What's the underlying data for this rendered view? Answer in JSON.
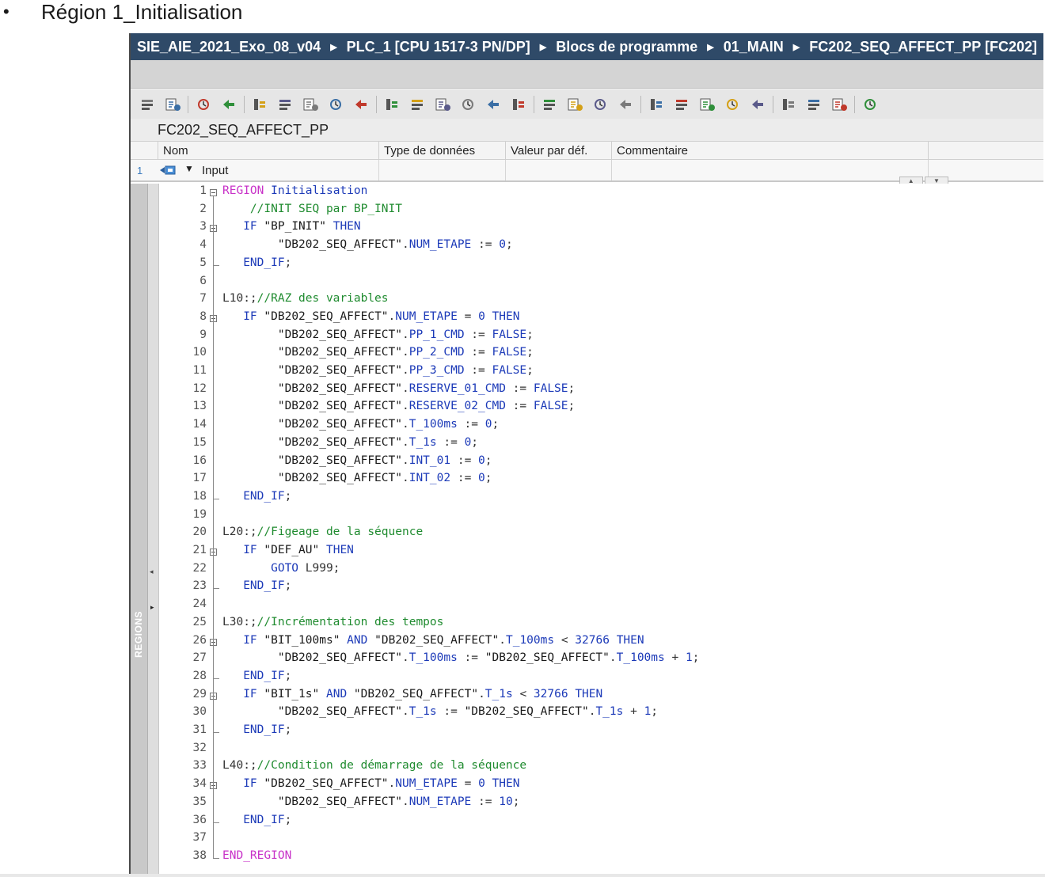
{
  "slide": {
    "bullet": "•",
    "title": "Région 1_Initialisation"
  },
  "breadcrumb": {
    "items": [
      "SIE_AIE_2021_Exo_08_v04",
      "PLC_1 [CPU 1517-3 PN/DP]",
      "Blocs de programme",
      "01_MAIN",
      "FC202_SEQ_AFFECT_PP [FC202]"
    ],
    "separator": "▶"
  },
  "toolbar": {
    "icons": [
      "insert-network-icon",
      "delete-network-icon",
      "insert-row-icon",
      "add-row-icon",
      "indent-icon",
      "outdent-icon",
      "comment-icon",
      "uncomment-icon",
      "favorites-icon",
      "breakpoint-icon",
      "clear-breakpoints-icon",
      "watch-icon",
      "snapshot-icon",
      "list-icon",
      "download-icon",
      "goto-prev-icon",
      "goto-next-icon",
      "expand-icon",
      "collapse-icon",
      "bookmark-icon",
      "bookmark-next-icon",
      "monitor-icon",
      "step-into-icon",
      "step-out-icon",
      "cross-ref-icon",
      "glasses-icon",
      "glasses-2-icon",
      "database-icon"
    ]
  },
  "block": {
    "title": "FC202_SEQ_AFFECT_PP"
  },
  "interface": {
    "columns": [
      "Nom",
      "Type de données",
      "Valeur par déf.",
      "Commentaire"
    ],
    "row": {
      "number": "1",
      "label": "Input"
    }
  },
  "regions_label": "REGIONS",
  "code_lines": [
    {
      "n": "1",
      "t": "REGION Initialisation"
    },
    {
      "n": "2",
      "t": "    //INIT SEQ par BP_INIT"
    },
    {
      "n": "3",
      "t": "    IF \"BP_INIT\" THEN"
    },
    {
      "n": "4",
      "t": "        \"DB202_SEQ_AFFECT\".NUM_ETAPE := 0;"
    },
    {
      "n": "5",
      "t": "    END_IF;"
    },
    {
      "n": "6",
      "t": ""
    },
    {
      "n": "7",
      "t": "L10:;//RAZ des variables"
    },
    {
      "n": "8",
      "t": "    IF \"DB202_SEQ_AFFECT\".NUM_ETAPE = 0 THEN"
    },
    {
      "n": "9",
      "t": "        \"DB202_SEQ_AFFECT\".PP_1_CMD := FALSE;"
    },
    {
      "n": "10",
      "t": "        \"DB202_SEQ_AFFECT\".PP_2_CMD := FALSE;"
    },
    {
      "n": "11",
      "t": "        \"DB202_SEQ_AFFECT\".PP_3_CMD := FALSE;"
    },
    {
      "n": "12",
      "t": "        \"DB202_SEQ_AFFECT\".RESERVE_01_CMD := FALSE;"
    },
    {
      "n": "13",
      "t": "        \"DB202_SEQ_AFFECT\".RESERVE_02_CMD := FALSE;"
    },
    {
      "n": "14",
      "t": "        \"DB202_SEQ_AFFECT\".T_100ms := 0;"
    },
    {
      "n": "15",
      "t": "        \"DB202_SEQ_AFFECT\".T_1s := 0;"
    },
    {
      "n": "16",
      "t": "        \"DB202_SEQ_AFFECT\".INT_01 := 0;"
    },
    {
      "n": "17",
      "t": "        \"DB202_SEQ_AFFECT\".INT_02 := 0;"
    },
    {
      "n": "18",
      "t": "    END_IF;"
    },
    {
      "n": "19",
      "t": ""
    },
    {
      "n": "20",
      "t": "L20:;//Figeage de la séquence"
    },
    {
      "n": "21",
      "t": "    IF \"DEF_AU\" THEN"
    },
    {
      "n": "22",
      "t": "        GOTO L999;"
    },
    {
      "n": "23",
      "t": "    END_IF;"
    },
    {
      "n": "24",
      "t": ""
    },
    {
      "n": "25",
      "t": "L30:;//Incrémentation des tempos"
    },
    {
      "n": "26",
      "t": "    IF \"BIT_100ms\" AND \"DB202_SEQ_AFFECT\".T_100ms < 32766 THEN"
    },
    {
      "n": "27",
      "t": "        \"DB202_SEQ_AFFECT\".T_100ms := \"DB202_SEQ_AFFECT\".T_100ms + 1;"
    },
    {
      "n": "28",
      "t": "    END_IF;"
    },
    {
      "n": "29",
      "t": "    IF \"BIT_1s\" AND \"DB202_SEQ_AFFECT\".T_1s < 32766 THEN"
    },
    {
      "n": "30",
      "t": "        \"DB202_SEQ_AFFECT\".T_1s := \"DB202_SEQ_AFFECT\".T_1s + 1;"
    },
    {
      "n": "31",
      "t": "    END_IF;"
    },
    {
      "n": "32",
      "t": ""
    },
    {
      "n": "33",
      "t": "L40:;//Condition de démarrage de la séquence"
    },
    {
      "n": "34",
      "t": "    IF \"DB202_SEQ_AFFECT\".NUM_ETAPE = 0 THEN"
    },
    {
      "n": "35",
      "t": "        \"DB202_SEQ_AFFECT\".NUM_ETAPE := 10;"
    },
    {
      "n": "36",
      "t": "    END_IF;"
    },
    {
      "n": "37",
      "t": ""
    },
    {
      "n": "38",
      "t": "END_REGION"
    }
  ],
  "colors": {
    "breadcrumb_bg": "#2f4a68",
    "keyword": "#1c3ab8",
    "region_keyword": "#c832c8",
    "comment": "#1f8b2f"
  }
}
